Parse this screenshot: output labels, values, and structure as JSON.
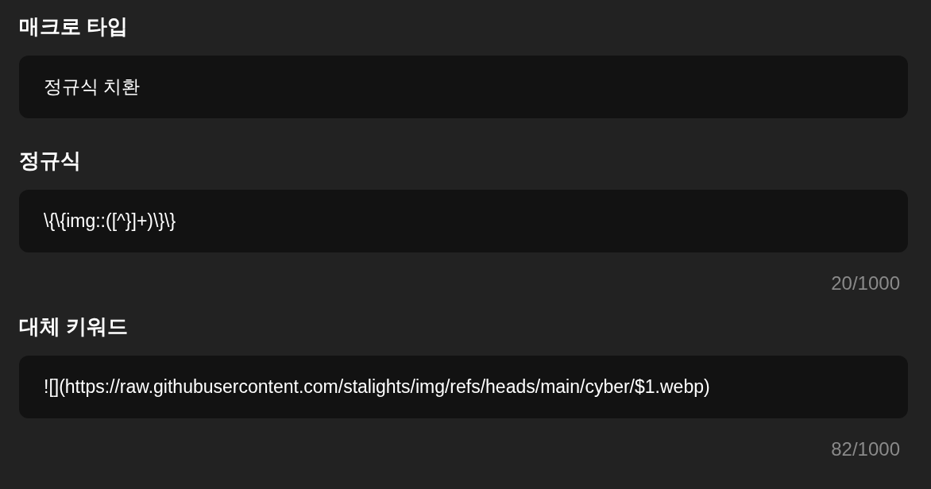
{
  "fields": [
    {
      "label": "매크로 타입",
      "value": "정규식 치환"
    },
    {
      "label": "정규식",
      "value": "\\{\\{img::([^}]+)\\}\\}",
      "counter": "20/1000"
    },
    {
      "label": "대체 키워드",
      "value": "![](https://raw.githubusercontent.com/stalights/img/refs/heads/main/cyber/$1.webp)",
      "counter": "82/1000"
    }
  ]
}
